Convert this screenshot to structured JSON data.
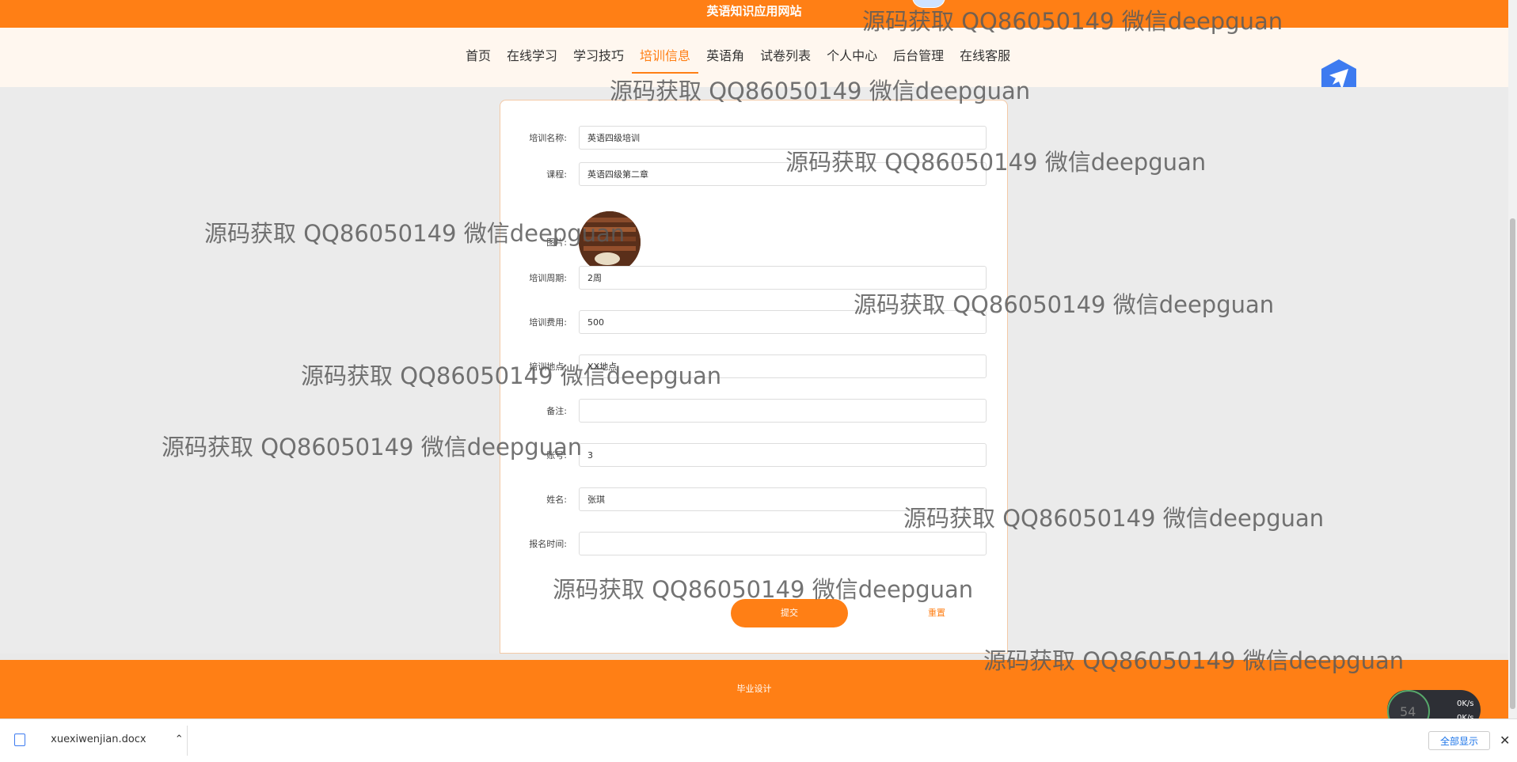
{
  "site": {
    "title": "英语知识应用网站"
  },
  "nav": {
    "items": [
      {
        "label": "首页"
      },
      {
        "label": "在线学习"
      },
      {
        "label": "学习技巧"
      },
      {
        "label": "培训信息"
      },
      {
        "label": "英语角"
      },
      {
        "label": "试卷列表"
      },
      {
        "label": "个人中心"
      },
      {
        "label": "后台管理"
      },
      {
        "label": "在线客服"
      }
    ],
    "active": "培训信息"
  },
  "form": {
    "training_name": {
      "label": "培训名称:",
      "value": "英语四级培训"
    },
    "course": {
      "label": "课程:",
      "value": "英语四级第二章"
    },
    "image": {
      "label": "图片:"
    },
    "period": {
      "label": "培训周期:",
      "value": "2周"
    },
    "fee": {
      "label": "培训费用:",
      "value": "500"
    },
    "location": {
      "label": "培训地点:",
      "value": "XX地点"
    },
    "remark": {
      "label": "备注:",
      "value": ""
    },
    "account": {
      "label": "账号:",
      "value": "3"
    },
    "name": {
      "label": "姓名:",
      "value": "张琪"
    },
    "signup_time": {
      "label": "报名时间:",
      "value": ""
    },
    "submit_label": "提交",
    "reset_label": "重置"
  },
  "footer": {
    "text": "毕业设计"
  },
  "watermark": {
    "text": "源码获取 QQ86050149 微信deepguan"
  },
  "speed": {
    "up": "0K/s",
    "down": "0K/s",
    "badge": "54"
  },
  "download_bar": {
    "file": "xuexiwenjian.docx",
    "show_all": "全部显示"
  },
  "colors": {
    "accent": "#ff7f15",
    "nav_bg": "#fff7ef",
    "page_bg": "#ebebeb"
  },
  "icons": [
    "bird-logo-icon",
    "chevron-up-icon",
    "close-icon",
    "doc-file-icon"
  ]
}
